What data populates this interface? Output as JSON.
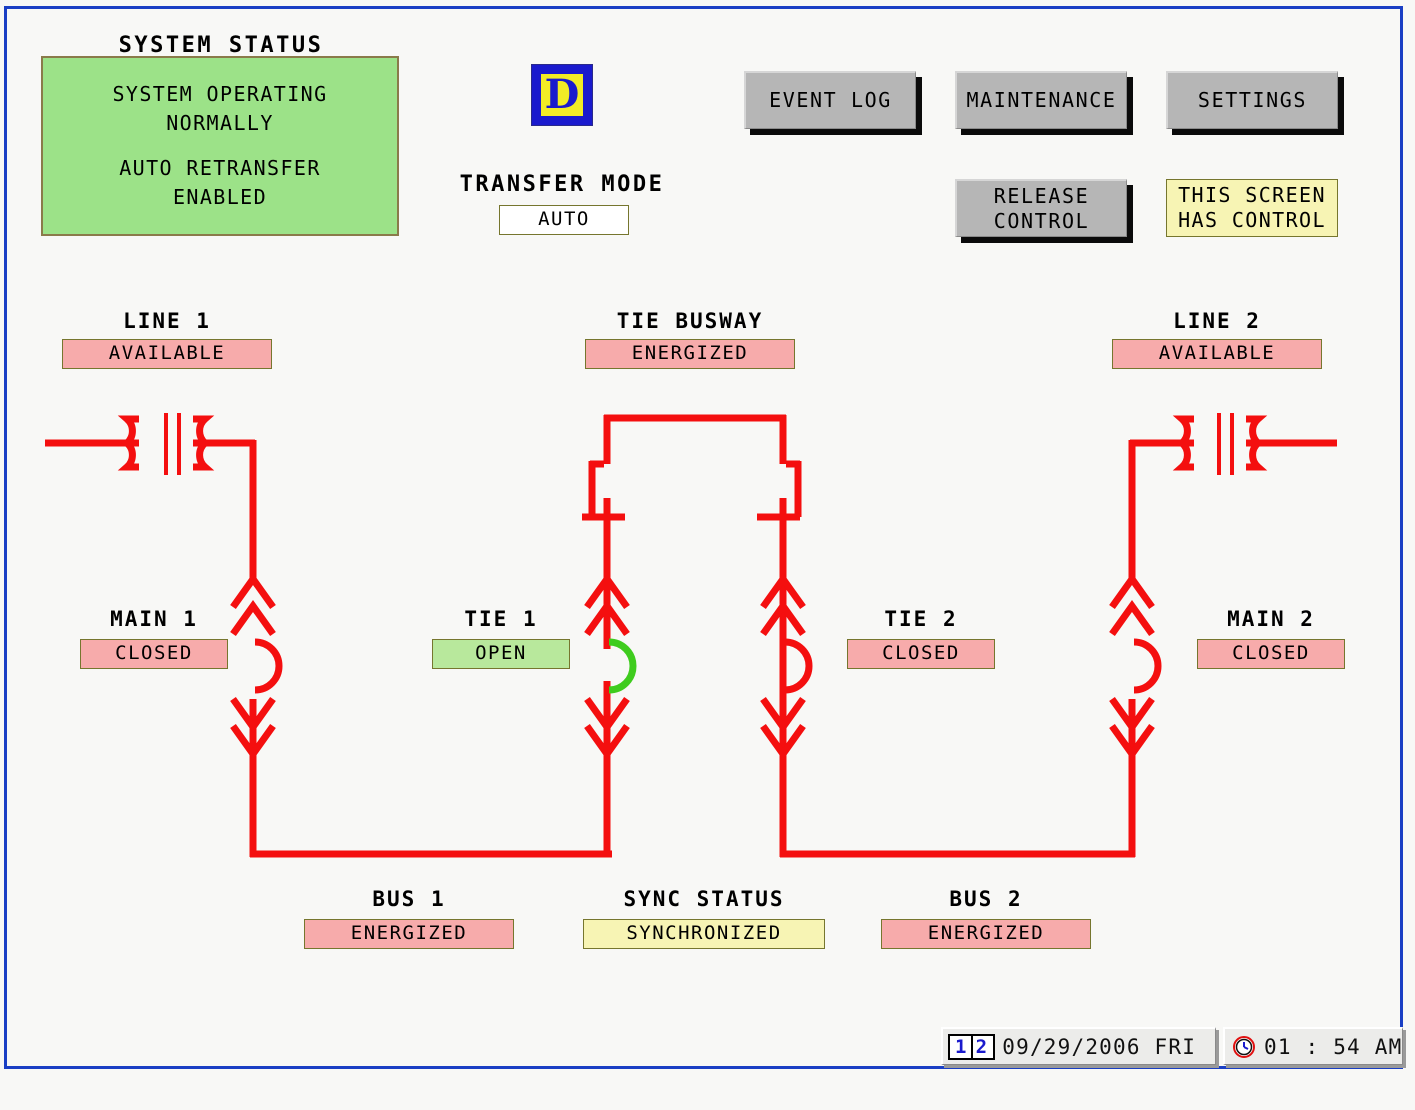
{
  "header": {
    "system_status_title": "SYSTEM STATUS",
    "system_status_line1": "SYSTEM OPERATING",
    "system_status_line2": "NORMALLY",
    "system_status_line3": "AUTO RETRANSFER",
    "system_status_line4": "ENABLED",
    "logo_letter": "D",
    "transfer_mode_title": "TRANSFER MODE",
    "transfer_mode_value": "AUTO"
  },
  "buttons": {
    "event_log": "EVENT LOG",
    "maintenance": "MAINTENANCE",
    "settings": "SETTINGS",
    "release_control_line1": "RELEASE",
    "release_control_line2": "CONTROL",
    "has_control_line1": "THIS SCREEN",
    "has_control_line2": "HAS CONTROL"
  },
  "diagram": {
    "line1": {
      "title": "LINE 1",
      "status": "AVAILABLE",
      "state": "red"
    },
    "tie_busway": {
      "title": "TIE BUSWAY",
      "status": "ENERGIZED",
      "state": "red"
    },
    "line2": {
      "title": "LINE 2",
      "status": "AVAILABLE",
      "state": "red"
    },
    "main1": {
      "title": "MAIN 1",
      "status": "CLOSED",
      "state": "red"
    },
    "tie1": {
      "title": "TIE 1",
      "status": "OPEN",
      "state": "green"
    },
    "tie2": {
      "title": "TIE 2",
      "status": "CLOSED",
      "state": "red"
    },
    "main2": {
      "title": "MAIN 2",
      "status": "CLOSED",
      "state": "red"
    },
    "bus1": {
      "title": "BUS 1",
      "status": "ENERGIZED",
      "state": "red"
    },
    "sync": {
      "title": "SYNC STATUS",
      "status": "SYNCHRONIZED",
      "state": "yellow"
    },
    "bus2": {
      "title": "BUS 2",
      "status": "ENERGIZED",
      "state": "red"
    }
  },
  "statusbar": {
    "page_left": "1",
    "page_right": "2",
    "date": "09/29/2006 FRI",
    "time": "01 : 54 AM"
  },
  "colors": {
    "energized_line": "#f40f0f",
    "open_breaker": "#3fcc1e",
    "status_red": "#f7abab",
    "status_green": "#b8e89c",
    "status_yellow": "#f7f4b4",
    "panel_green": "#9ce288",
    "frame_blue": "#1a3fc4",
    "logo_blue": "#1a1acd",
    "logo_yellow": "#f2ec26"
  }
}
